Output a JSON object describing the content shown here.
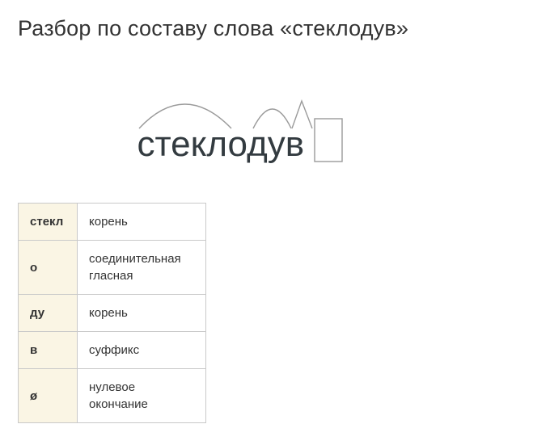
{
  "title": "Разбор по составу слова «стеклодув»",
  "word": {
    "segments": {
      "root1": "стекл",
      "connective": "о",
      "root2": "ду",
      "suffix": "в"
    }
  },
  "table": {
    "rows": [
      {
        "part": "стекл",
        "desc": "корень"
      },
      {
        "part": "о",
        "desc": "соединительная гласная"
      },
      {
        "part": "ду",
        "desc": "корень"
      },
      {
        "part": "в",
        "desc": "суффикс"
      },
      {
        "part": "ø",
        "desc": "нулевое окончание"
      }
    ]
  }
}
